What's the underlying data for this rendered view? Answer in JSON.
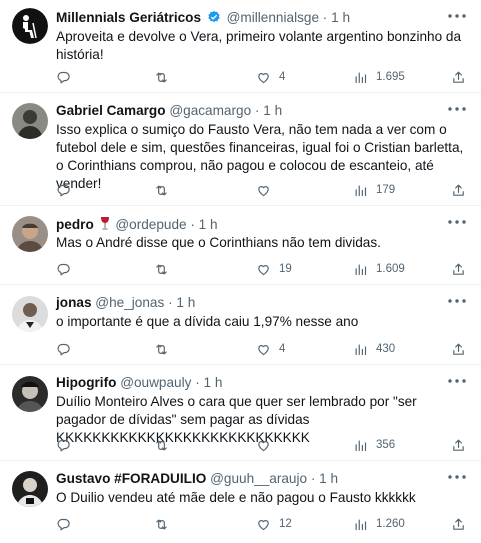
{
  "tweets": [
    {
      "name": "Millennials Geriátricos",
      "handle": "@millennialsge",
      "time": "1 h",
      "text": "Aproveita e devolve o Vera, primeiro volante argentino bonzinho da história!",
      "replies": "",
      "retweets": "",
      "likes": "4",
      "views": "1.695",
      "verified": true,
      "avatar_color": "#111111"
    },
    {
      "name": "Gabriel Camargo",
      "handle": "@gacamargo",
      "time": "1 h",
      "text": "Isso explica o sumiço do Fausto Vera, não tem nada a ver com o futebol dele e sim, questões financeiras, igual foi o Cristian barletta, o Corinthians comprou, não pagou e colocou de escanteio, até vender!",
      "replies": "",
      "retweets": "",
      "likes": "",
      "views": "179",
      "avatar_color": "#3b3a36"
    },
    {
      "name": "pedro",
      "handle": "@ordepude",
      "time": "1 h",
      "text": "Mas o André disse que o Corinthians não tem dividas.",
      "replies": "",
      "retweets": "",
      "likes": "19",
      "views": "1.609",
      "emoji": "wine-glass",
      "avatar_color": "#6b5a4e"
    },
    {
      "name": "jonas",
      "handle": "@he_jonas",
      "time": "1 h",
      "text": "o importante é que a dívida caiu 1,97% nesse ano",
      "replies": "",
      "retweets": "",
      "likes": "4",
      "views": "430",
      "avatar_color": "#c8c8c8"
    },
    {
      "name": "Hipogrifo",
      "handle": "@ouwpauly",
      "time": "1 h",
      "text": "Duílio Monteiro Alves o cara que quer ser lembrado por \"ser pagador de dívidas\" sem pagar as dívidas KKKKKKKKKKKKKKKKKKKKKKKKKKKK",
      "replies": "",
      "retweets": "",
      "likes": "",
      "views": "356",
      "avatar_color": "#4a4a4a"
    },
    {
      "name": "Gustavo #FORADUILIO",
      "handle": "@guuh__araujo",
      "time": "1 h",
      "text": "O Duilio vendeu até mãe dele e não pagou o Fausto kkkkkk",
      "replies": "",
      "retweets": "",
      "likes": "12",
      "views": "1.260",
      "avatar_color": "#2a2a2a"
    }
  ],
  "colors": {
    "text": "#0f1419",
    "secondary": "#536471",
    "verified": "#1d9bf0",
    "divider": "#eff3f4"
  },
  "icons": [
    "more-icon",
    "reply-icon",
    "retweet-icon",
    "like-icon",
    "views-icon",
    "share-icon",
    "verified-icon"
  ]
}
